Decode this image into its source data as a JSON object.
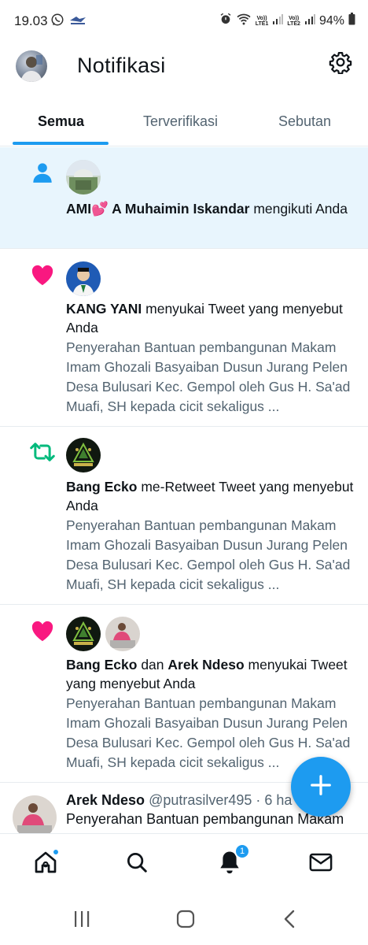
{
  "status_bar": {
    "time": "19.03",
    "sim1": [
      "Vo))",
      "LTE1"
    ],
    "sim2": [
      "Vo))",
      "LTE2"
    ],
    "battery": "94%"
  },
  "header": {
    "title": "Notifikasi"
  },
  "tabs": [
    {
      "label": "Semua",
      "active": true
    },
    {
      "label": "Terverifikasi",
      "active": false
    },
    {
      "label": "Sebutan",
      "active": false
    }
  ],
  "notifications": [
    {
      "type": "follow",
      "icon": "person-icon",
      "name": "AMI💕 A Muhaimin Iskandar",
      "action": " mengikuti Anda"
    },
    {
      "type": "like",
      "icon": "heart-icon",
      "name": "KANG YANI",
      "action": " menyukai Tweet yang menyebut Anda",
      "preview": "Penyerahan Bantuan pembangunan Makam Imam Ghozali Basyaiban Dusun Jurang Pelen Desa Bulusari Kec. Gempol oleh Gus H. Sa'ad Muafi, SH kepada cicit sekaligus ..."
    },
    {
      "type": "retweet",
      "icon": "retweet-icon",
      "name": "Bang Ecko",
      "action": " me-Retweet Tweet yang menyebut Anda",
      "preview": "Penyerahan Bantuan pembangunan Makam Imam Ghozali Basyaiban Dusun Jurang Pelen Desa Bulusari Kec. Gempol oleh Gus H. Sa'ad Muafi, SH kepada cicit sekaligus ..."
    },
    {
      "type": "like",
      "icon": "heart-icon",
      "name": "Bang Ecko",
      "connector": " dan ",
      "name2": "Arek Ndeso",
      "action": " menyukai Tweet yang menyebut Anda",
      "preview": "Penyerahan Bantuan pembangunan Makam Imam Ghozali Basyaiban Dusun Jurang Pelen Desa Bulusari Kec. Gempol oleh Gus H. Sa'ad Muafi, SH kepada cicit sekaligus ..."
    }
  ],
  "tweet": {
    "name": "Arek Ndeso",
    "handle": "@putrasilver495",
    "meta": " · 6 ha",
    "text": "Penyerahan Bantuan pembangunan Makam"
  },
  "bottom_nav": {
    "notifications_badge": "1"
  },
  "colors": {
    "accent": "#1d9bf0",
    "like": "#f91880",
    "retweet": "#00ba7c",
    "highlight_bg": "#e8f5fd"
  }
}
